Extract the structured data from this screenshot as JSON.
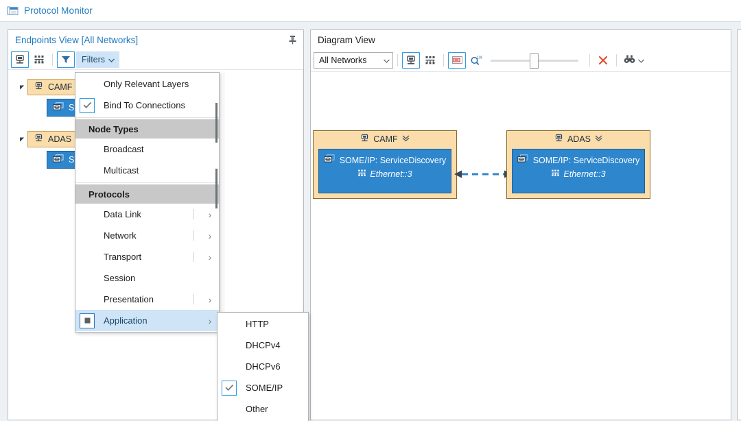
{
  "window": {
    "title": "Protocol Monitor",
    "icon": "app-window-icon"
  },
  "endpoints_panel": {
    "caption": "Endpoints View [All Networks]",
    "pin_icon": "pin-icon",
    "toolbar": {
      "buttons": [
        {
          "name": "endpoint-node-view-button",
          "icon": "endpoint-node-icon",
          "checked": true
        },
        {
          "name": "network-view-button",
          "icon": "network-grid-icon",
          "checked": false
        }
      ],
      "filter_icon_button": {
        "name": "filter-funnel-button",
        "icon": "funnel-icon",
        "checked": true
      },
      "filters_label": "Filters",
      "filters_caret": "chevron-down-icon"
    },
    "tree": [
      {
        "expander": "triangle-collapse-icon",
        "icon": "endpoint-node-icon",
        "label": "CAMF",
        "children": [
          {
            "icon": "message-icon",
            "label": "S"
          }
        ]
      },
      {
        "expander": "triangle-collapse-icon",
        "icon": "endpoint-node-icon",
        "label": "ADAS",
        "children": [
          {
            "icon": "message-icon",
            "label": "S"
          }
        ]
      }
    ]
  },
  "filters_menu": {
    "items": [
      {
        "type": "check",
        "label": "Only Relevant Layers",
        "checked": false,
        "submenu": false
      },
      {
        "type": "check",
        "label": "Bind To Connections",
        "checked": true,
        "submenu": false
      },
      {
        "type": "separator"
      },
      {
        "type": "header",
        "label": "Node Types"
      },
      {
        "type": "check",
        "label": "Broadcast",
        "checked": false,
        "submenu": false
      },
      {
        "type": "check",
        "label": "Multicast",
        "checked": false,
        "submenu": false
      },
      {
        "type": "separator"
      },
      {
        "type": "header",
        "label": "Protocols"
      },
      {
        "type": "check",
        "label": "Data Link",
        "checked": false,
        "submenu": true
      },
      {
        "type": "check",
        "label": "Network",
        "checked": false,
        "submenu": true
      },
      {
        "type": "check",
        "label": "Transport",
        "checked": false,
        "submenu": true
      },
      {
        "type": "check",
        "label": "Session",
        "checked": false,
        "submenu": false
      },
      {
        "type": "check",
        "label": "Presentation",
        "checked": false,
        "submenu": true
      },
      {
        "type": "check",
        "label": "Application",
        "checked": "partial",
        "submenu": true,
        "highlighted": true
      }
    ]
  },
  "application_submenu": {
    "items": [
      {
        "label": "HTTP",
        "checked": false
      },
      {
        "label": "DHCPv4",
        "checked": false
      },
      {
        "label": "DHCPv6",
        "checked": false
      },
      {
        "label": "SOME/IP",
        "checked": true
      },
      {
        "label": "Other",
        "checked": false
      }
    ]
  },
  "diagram_panel": {
    "caption": "Diagram View",
    "toolbar": {
      "network_select": {
        "value": "All Networks",
        "caret": "chevron-down-icon"
      },
      "buttons": [
        {
          "name": "endpoint-node-view-button",
          "icon": "endpoint-node-icon",
          "checked": true
        },
        {
          "name": "network-grid-view-button",
          "icon": "network-grid-icon",
          "checked": false
        },
        {
          "name": "show-labels-button",
          "icon": "label-box-icon",
          "checked": true
        },
        {
          "name": "zoom-100-button",
          "icon": "magnifier-100-icon",
          "checked": false
        }
      ],
      "zoom_slider": {
        "name": "zoom-slider",
        "value": 50
      },
      "clear_button": {
        "name": "clear-button",
        "icon": "red-x-icon",
        "color": "#e8482a"
      },
      "find_button": {
        "name": "find-button",
        "icon": "binoculars-icon",
        "caret": "chevron-down-icon"
      }
    },
    "nodes": [
      {
        "title": "CAMF",
        "title_icon": "endpoint-node-icon",
        "collapse_icon": "double-chevron-down-icon",
        "protocol_icon": "message-icon",
        "protocol": "SOME/IP:  ServiceDiscovery",
        "interface_icon": "network-grid-icon",
        "interface": "Ethernet::3"
      },
      {
        "title": "ADAS",
        "title_icon": "endpoint-node-icon",
        "collapse_icon": "double-chevron-down-icon",
        "protocol_icon": "message-icon",
        "protocol": "SOME/IP:  ServiceDiscovery",
        "interface_icon": "network-grid-icon",
        "interface": "Ethernet::3"
      }
    ],
    "connection": {
      "name": "bidirectional-connection",
      "style": "dashed",
      "color": "#2e86cd"
    }
  },
  "colors": {
    "accent_blue": "#1f7bc1",
    "node_fill": "#fbddab",
    "service_fill": "#2e86cd",
    "menu_highlight": "#cfe4f7",
    "menu_header": "#c8c8c8",
    "red_x": "#e8482a"
  }
}
